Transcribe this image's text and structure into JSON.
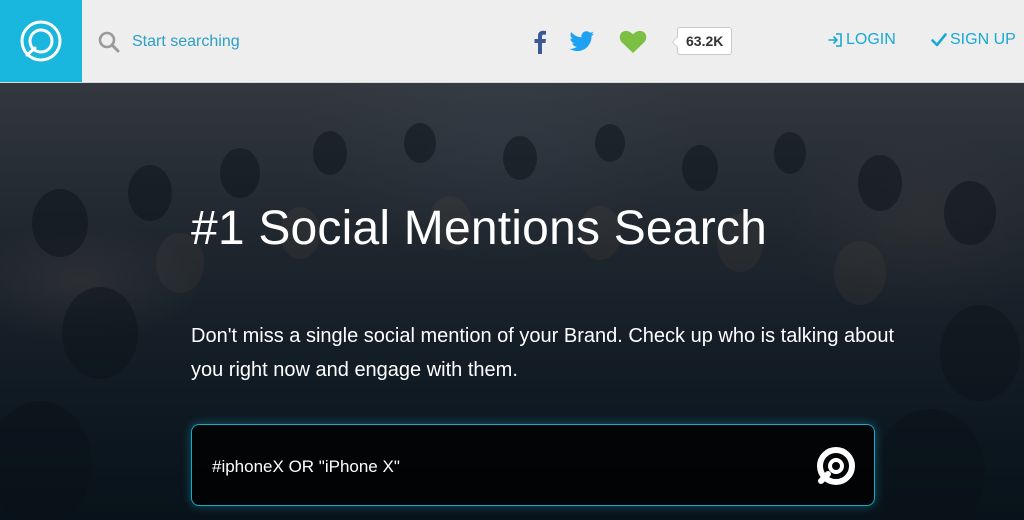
{
  "header": {
    "search_placeholder": "Start searching",
    "share_count": "63.2K",
    "login_label": "LOGIN",
    "signup_label": "SIGN UP"
  },
  "icons": {
    "logo": "social-mention-logo",
    "search": "search-icon",
    "facebook": "facebook-icon",
    "twitter": "twitter-icon",
    "heart": "heart-icon",
    "login": "login-icon",
    "signup": "checkmark-icon",
    "submit": "search-submit-icon"
  },
  "hero": {
    "headline": "#1 Social Mentions Search",
    "subtext": "Don't miss a single social mention of your Brand. Check up who is talking about you right now and engage with them.",
    "search_value": "#iphoneX OR \"iPhone X\""
  },
  "colors": {
    "brand": "#19b6dd",
    "link": "#19a9d4",
    "facebook": "#3b5998",
    "twitter": "#1da1f2",
    "heart": "#7bc043",
    "topbar_bg": "#eeeeee"
  }
}
